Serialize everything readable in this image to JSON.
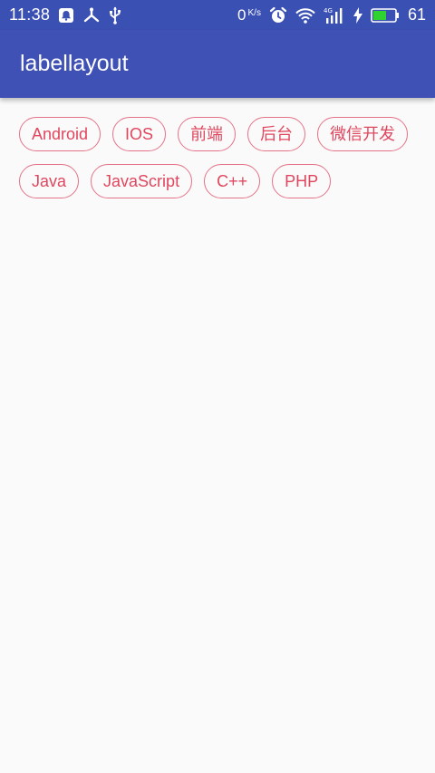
{
  "status_bar": {
    "time": "11:38",
    "net_speed": "0",
    "net_unit": "K/s",
    "battery_level": "61",
    "icons": [
      "notification-icon",
      "share-icon",
      "usb-icon",
      "alarm-icon",
      "wifi-icon",
      "signal-4g-icon",
      "charging-icon",
      "battery-icon"
    ],
    "battery_fill_fraction": 0.61
  },
  "app_bar": {
    "title": "labellayout",
    "color": "#3f51b5"
  },
  "labels": {
    "accent_color": "#e0475f",
    "items": [
      "Android",
      "IOS",
      "前端",
      "后台",
      "微信开发",
      "Java",
      "JavaScript",
      "C++",
      "PHP"
    ]
  }
}
